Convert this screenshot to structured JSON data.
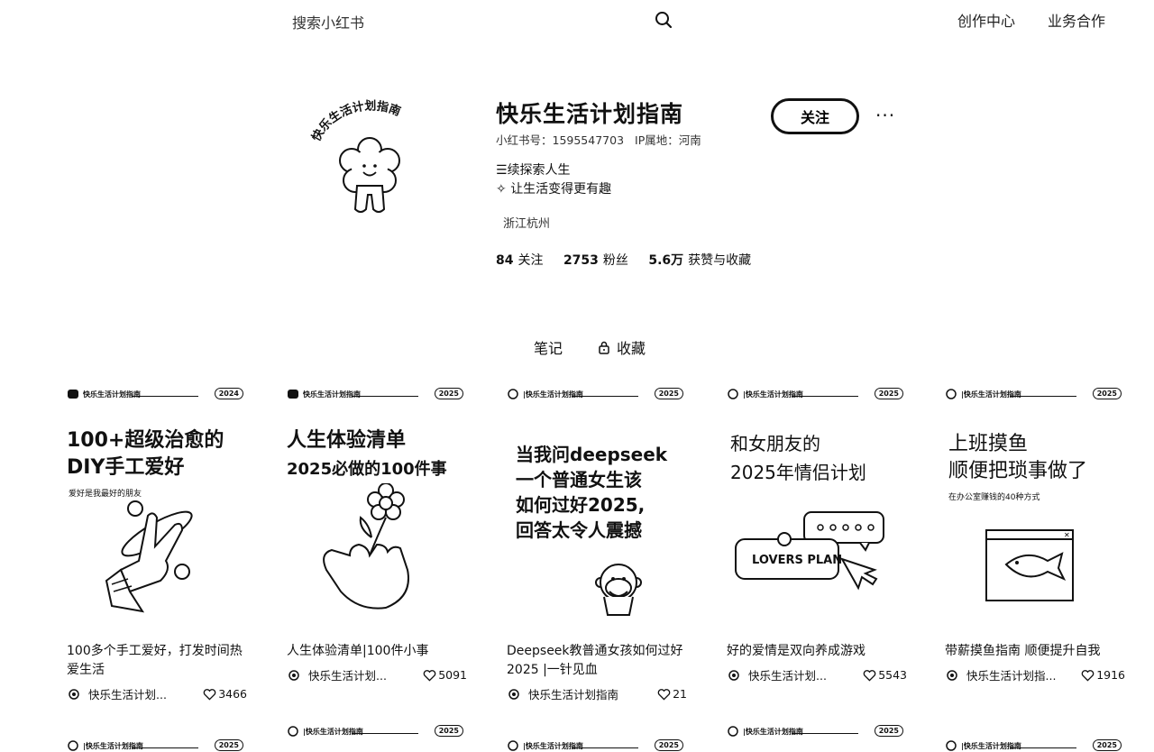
{
  "topbar": {
    "search_placeholder": "搜索小红书",
    "creator_center": "创作中心",
    "business": "业务合作"
  },
  "profile": {
    "name": "快乐生活计划指南",
    "avatar_text": "快乐生活计划指南",
    "redbook_id": "小红书号：1595547703",
    "ip": "IP属地：河南",
    "bio_line1": "续探索人生",
    "bio_line2": "让生活变得更有趣",
    "location": "浙江杭州",
    "following_count": "84",
    "following_label": "关注",
    "followers_count": "2753",
    "followers_label": "粉丝",
    "likes_count": "5.6万",
    "likes_label": "获赞与收藏",
    "follow_button": "关注",
    "more_button": "···"
  },
  "tabs": {
    "notes": "笔记",
    "favorites": "收藏"
  },
  "notes": [
    {
      "cover_brand": "快乐生活计划指南",
      "cover_year": "2024",
      "cover_title1": "100+超级治愈的",
      "cover_title2": "DIY手工爱好",
      "cover_sub": "爱好是我最好的朋友",
      "title": "100多个手工爱好，打发时间热爱生活",
      "author": "快乐生活计划...",
      "likes": "3466"
    },
    {
      "cover_brand": "快乐生活计划指南",
      "cover_year": "2025",
      "cover_title1": "人生体验清单",
      "cover_title2": "2025必做的100件事",
      "cover_sub": "",
      "title": "人生体验清单|100件小事",
      "author": "快乐生活计划...",
      "likes": "5091"
    },
    {
      "cover_brand": "|快乐生活计划指南",
      "cover_year": "2025",
      "cover_title1": "当我问deepseek",
      "cover_title2": "一个普通女生该",
      "cover_title3": "如何过好2025,",
      "cover_title4": "回答太令人震撼",
      "cover_sub": "",
      "title": "Deepseek教普通女孩如何过好2025 |一针见血",
      "author": "快乐生活计划指南",
      "likes": "21"
    },
    {
      "cover_brand": "|快乐生活计划指南",
      "cover_year": "2025",
      "cover_title1": "和女朋友的",
      "cover_title2": "2025年情侣计划",
      "cover_sub": "LOVERS PLAN",
      "title": "好的爱情是双向养成游戏",
      "author": "快乐生活计划...",
      "likes": "5543"
    },
    {
      "cover_brand": "|快乐生活计划指南",
      "cover_year": "2025",
      "cover_title1": "上班摸鱼",
      "cover_title2": "顺便把琐事做了",
      "cover_sub": "在办公室赚钱的40种方式",
      "title": "带薪摸鱼指南 顺便提升自我",
      "author": "快乐生活计划指...",
      "likes": "1916"
    }
  ],
  "row2": [
    {
      "cover_brand": "|快乐生活计划指南",
      "cover_year": "2025"
    },
    {
      "cover_brand": "|快乐生活计划指南",
      "cover_year": "2025"
    },
    {
      "cover_brand": "|快乐生活计划指南",
      "cover_year": "2025"
    },
    {
      "cover_brand": "|快乐生活计划指南",
      "cover_year": "2025"
    },
    {
      "cover_brand": "|快乐生活计划指南",
      "cover_year": "2025"
    }
  ]
}
